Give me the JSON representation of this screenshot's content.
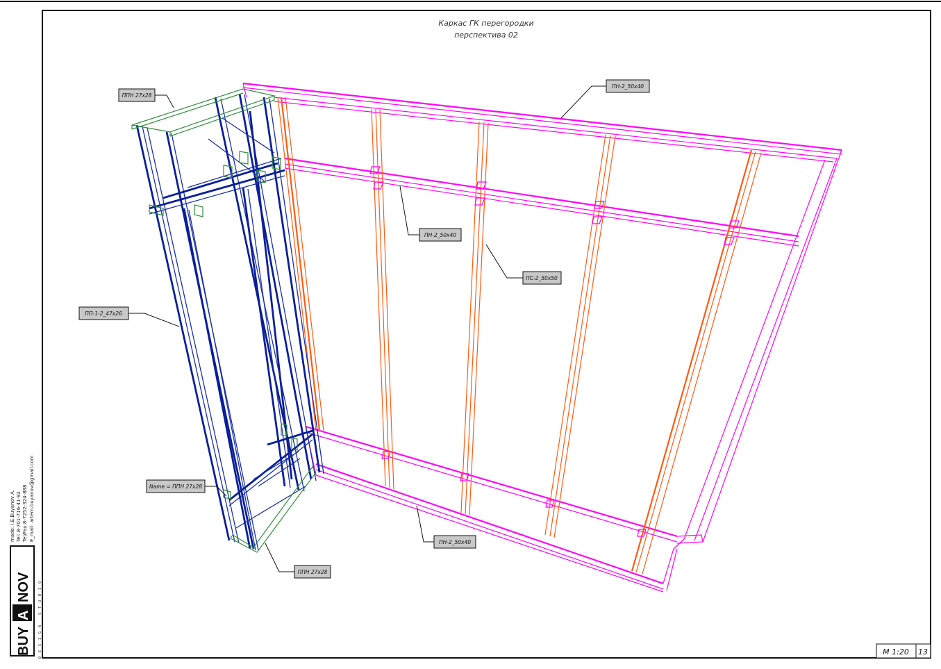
{
  "title": {
    "line1": "Каркас ГК перегородки",
    "line2": "перспектива 02"
  },
  "labels": [
    {
      "id": "ppn-top",
      "text": "ППН 27x28"
    },
    {
      "id": "pn-top-right",
      "text": "ПН-2_50x40"
    },
    {
      "id": "pn-middle",
      "text": "ПН-2_50x40"
    },
    {
      "id": "ps-stud",
      "text": "ПС-2_50x50"
    },
    {
      "id": "pp-left",
      "text": "ПП-1-2_47x26"
    },
    {
      "id": "ppn-name",
      "text": "Name = ППН 27x28"
    },
    {
      "id": "pn-bottom",
      "text": "ПН-2_50x40"
    },
    {
      "id": "ppn-bottom",
      "text": "ППН 27x28"
    }
  ],
  "side_info": {
    "made": "made: I.E.Buyanov A.",
    "tel": "Tel: 8-701-716-41-92",
    "telfax": "Tel/Fax:8-7252-324-888",
    "email": "E_mail: artem.buyanov@gmail.com"
  },
  "logo": {
    "part1": "BUY",
    "part2": "A",
    "part3": "NOV",
    "tagline": "DESIGN STUDIO"
  },
  "stamp": {
    "scale": "М 1:20",
    "sheet": "13"
  },
  "colors": {
    "guide_profile": "#ff00ff",
    "stud_profile": "#ff5a10",
    "ceiling_profile": "#1a2fa8",
    "ppn_connector": "#2f8f3a"
  }
}
